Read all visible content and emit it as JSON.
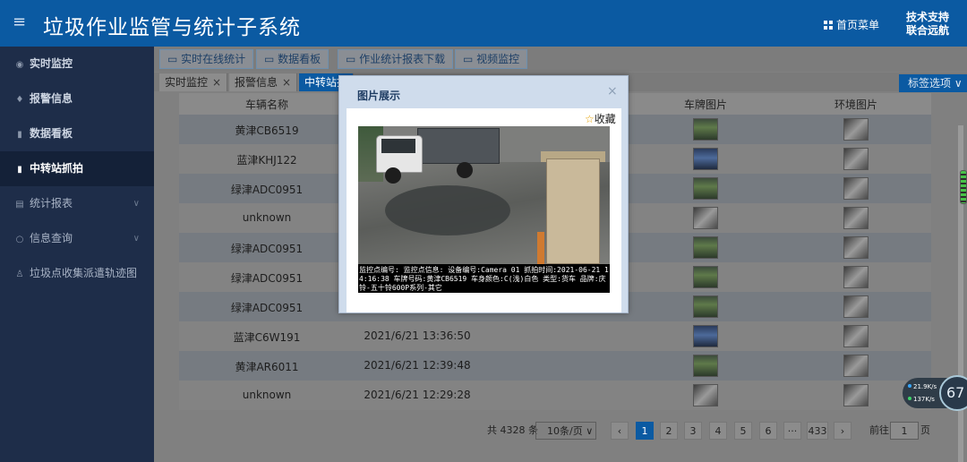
{
  "header": {
    "menu_icon": "hamburger-icon",
    "title": "垃圾作业监管与统计子系统",
    "home_menu": "首页菜单",
    "support_line1": "技术支持",
    "support_line2": "联合远航"
  },
  "sidebar": {
    "items": [
      {
        "label": "实时监控",
        "icon": "location-pin-icon"
      },
      {
        "label": "报警信息",
        "icon": "map-marker-icon"
      },
      {
        "label": "数据看板",
        "icon": "bar-chart-icon"
      },
      {
        "label": "中转站抓拍",
        "icon": "bar-chart-icon",
        "active": true
      },
      {
        "label": "统计报表",
        "icon": "document-icon",
        "expandable": true
      },
      {
        "label": "信息查询",
        "icon": "search-icon",
        "expandable": true
      },
      {
        "label": "垃圾点收集派遣轨迹图",
        "icon": "user-icon"
      }
    ]
  },
  "toolbar": {
    "buttons": [
      "实时在线统计",
      "数据看板",
      "作业统计报表下载",
      "视频监控"
    ]
  },
  "tabs": {
    "items": [
      "实时监控",
      "报警信息",
      "中转站抓"
    ],
    "tag_options": "标签选项"
  },
  "table": {
    "columns": [
      "车辆名称",
      "车牌图片",
      "环境图片"
    ],
    "rows": [
      {
        "name": "黄津CB6519",
        "time": ""
      },
      {
        "name": "蓝津KHJ122",
        "time": ""
      },
      {
        "name": "绿津ADC0951",
        "time": ""
      },
      {
        "name": "unknown",
        "time": ""
      },
      {
        "name": "绿津ADC0951",
        "time": ""
      },
      {
        "name": "绿津ADC0951",
        "time": ""
      },
      {
        "name": "绿津ADC0951",
        "time": ""
      },
      {
        "name": "蓝津C6W191",
        "time": "2021/6/21 13:36:50"
      },
      {
        "name": "黄津AR6011",
        "time": "2021/6/21 12:39:48"
      },
      {
        "name": "unknown",
        "time": "2021/6/21 12:29:28"
      }
    ]
  },
  "pager": {
    "total": "共 4328 条",
    "page_size": "10条/页",
    "pages": [
      "1",
      "2",
      "3",
      "4",
      "5",
      "6",
      "···",
      "433"
    ],
    "current_page": 1,
    "goto_label": "前往",
    "goto_value": "1",
    "page_unit": "页"
  },
  "modal": {
    "title": "图片展示",
    "close": "×",
    "favorite": "收藏",
    "caption": "监控点编号: 监控点信息: 设备编号:Camera 01 抓拍时间:2021-06-21 14:16:38 车牌号码:黄津CB6519 车身颜色:C(浅)白色 类型:货车 品牌:庆铃-五十铃600P系列-其它"
  },
  "overlay_widget": {
    "upload": "21.9K/s",
    "download": "137K/s",
    "gauge": "67"
  },
  "colors": {
    "header": "#0b5aa2",
    "sidebar": "#1e2d49",
    "accent": "#0b5aa2"
  }
}
